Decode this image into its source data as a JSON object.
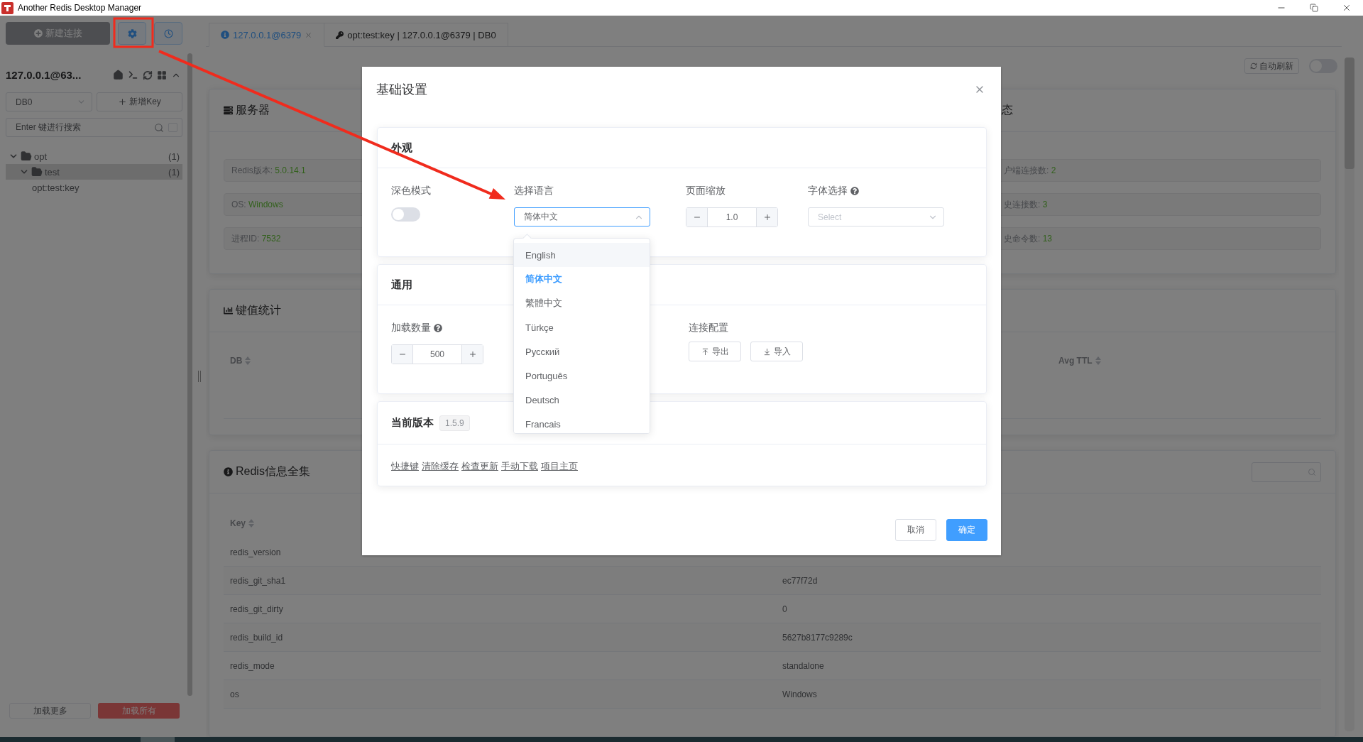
{
  "window": {
    "title": "Another Redis Desktop Manager"
  },
  "sidebar": {
    "new_connection_button": "新建连接",
    "connection": {
      "title": "127.0.0.1@63...",
      "expanded": true
    },
    "db_select": "DB0",
    "new_key_button": "新增Key",
    "search": {
      "placeholder": "Enter 键进行搜索",
      "checked": false
    },
    "tree": [
      {
        "label": "opt",
        "count": "(1)",
        "expanded": true,
        "selected": false,
        "children": [
          {
            "label": "test",
            "count": "(1)",
            "expanded": true,
            "selected": true,
            "children": [
              {
                "label": "opt:test:key",
                "selected": false
              }
            ]
          }
        ]
      }
    ],
    "load_more_button": "加载更多",
    "load_all_button": "加载所有"
  },
  "tabs": [
    {
      "label": "127.0.0.1@6379",
      "kind": "connection",
      "selected": true,
      "closable": true
    },
    {
      "label": "opt:test:key | 127.0.0.1@6379 | DB0",
      "kind": "key",
      "selected": false,
      "closable": false
    }
  ],
  "auto_refresh": {
    "label": "自动刷新",
    "on": false
  },
  "server_card": {
    "title": "服务器",
    "items": [
      {
        "label": "Redis版本:",
        "value": "5.0.14.1"
      },
      {
        "label": "OS:",
        "value": "Windows"
      },
      {
        "label": "进程ID:",
        "value": "7532"
      }
    ]
  },
  "status_card": {
    "title": "态",
    "items": [
      {
        "label": "户端连接数:",
        "value": "2"
      },
      {
        "label": "史连接数:",
        "value": "3"
      },
      {
        "label": "史命令数:",
        "value": "13"
      }
    ]
  },
  "key_stats": {
    "title": "键值统计",
    "columns": [
      "DB",
      "Avg TTL"
    ]
  },
  "info": {
    "title": "Redis信息全集",
    "columns": [
      "Key"
    ],
    "rows": [
      {
        "key": "redis_version"
      },
      {
        "key": "redis_git_sha1",
        "value": "ec77f72d"
      },
      {
        "key": "redis_git_dirty",
        "value": "0"
      },
      {
        "key": "redis_build_id",
        "value": "5627b8177c9289c"
      },
      {
        "key": "redis_mode",
        "value": "standalone"
      },
      {
        "key": "os",
        "value": "Windows"
      }
    ]
  },
  "dialog": {
    "title": "基础设置",
    "appearance": {
      "title": "外观",
      "dark_mode": {
        "label": "深色模式",
        "on": false
      },
      "language": {
        "label": "选择语言",
        "value": "简体中文",
        "expanded": true,
        "options": [
          {
            "label": "English",
            "hovered": true,
            "selected": false
          },
          {
            "label": "简体中文",
            "hovered": false,
            "selected": true
          },
          {
            "label": "繁體中文",
            "hovered": false,
            "selected": false
          },
          {
            "label": "Türkçe",
            "hovered": false,
            "selected": false
          },
          {
            "label": "Русский",
            "hovered": false,
            "selected": false
          },
          {
            "label": "Português",
            "hovered": false,
            "selected": false
          },
          {
            "label": "Deutsch",
            "hovered": false,
            "selected": false
          },
          {
            "label": "Francais",
            "hovered": false,
            "selected": false
          }
        ]
      },
      "zoom": {
        "label": "页面缩放",
        "value": "1.0"
      },
      "font": {
        "label": "字体选择",
        "placeholder": "Select"
      }
    },
    "general": {
      "title": "通用",
      "load_count": {
        "label": "加载数量",
        "value": "500"
      },
      "connection_config": {
        "label": "连接配置",
        "buttons": [
          "导出",
          "导入"
        ]
      }
    },
    "version": {
      "title": "当前版本",
      "badge": "1.5.9",
      "links": [
        "快捷键",
        "清除缓存",
        "检查更新",
        "手动下载",
        "项目主页"
      ]
    },
    "buttons": [
      {
        "label": "取消",
        "kind": "default"
      },
      {
        "label": "确定",
        "kind": "primary"
      }
    ]
  }
}
